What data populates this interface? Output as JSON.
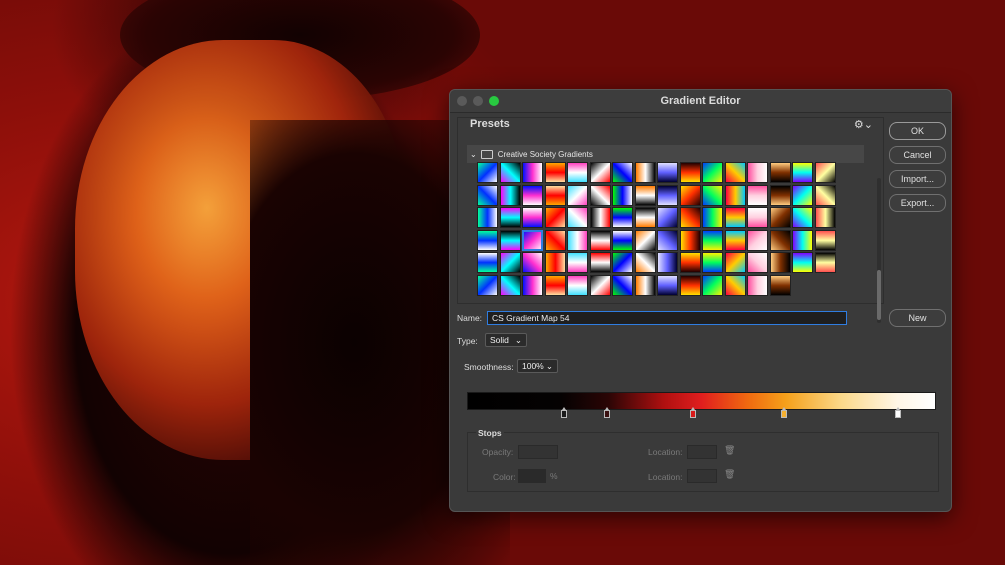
{
  "dialog": {
    "title": "Gradient Editor",
    "presets_label": "Presets",
    "folder_name": "Creative Society Gradients",
    "buttons": {
      "ok": "OK",
      "cancel": "Cancel",
      "import": "Import...",
      "export": "Export...",
      "new": "New"
    },
    "name_label": "Name:",
    "name_value": "CS Gradient Map 54",
    "type_label": "Type:",
    "type_value": "Solid",
    "smoothness_label": "Smoothness:",
    "smoothness_value": "100%",
    "stops": {
      "label": "Stops",
      "opacity_label": "Opacity:",
      "color_label": "Color:",
      "location_label": "Location:",
      "location_label2": "Location:",
      "percent_sign": "%"
    }
  },
  "colors": {
    "accent": "#2f7de1",
    "traffic_close": "#5a5a5a",
    "traffic_min": "#5a5a5a",
    "traffic_zoom": "#28c940",
    "stop_colors": [
      "#1a1a1a",
      "#3a1010",
      "#d81818",
      "#f5b030",
      "#ffffff"
    ]
  },
  "icons": {
    "gear": "gear-icon",
    "folder": "folder-icon",
    "chevron": "chevron-down-icon",
    "trash": "trash-icon"
  }
}
